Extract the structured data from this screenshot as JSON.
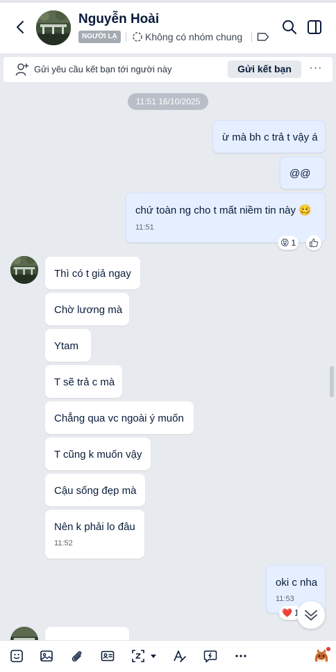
{
  "header": {
    "contact_name": "Nguyễn Hoài",
    "stranger_badge": "NGƯỜI LẠ",
    "mutual_groups": "Không có nhóm chung"
  },
  "friend_request": {
    "text": "Gửi yêu cầu kết bạn tới người này",
    "button_label": "Gửi kết bạn",
    "more_label": "···"
  },
  "conversation": {
    "date_divider": "11:51 16/10/2025",
    "messages": [
      {
        "sender": "me",
        "text": "ừ mà bh c trả t vậy á"
      },
      {
        "sender": "me",
        "text": "@@"
      },
      {
        "sender": "me",
        "text": "chứ toàn ng cho t mất niềm tin này",
        "emoji": "🥴",
        "time": "11:51",
        "reaction": {
          "emoji": "😝",
          "count": "1"
        }
      },
      {
        "sender": "them",
        "text": "Thì có t giả ngay"
      },
      {
        "sender": "them",
        "text": "Chờ lương mà"
      },
      {
        "sender": "them",
        "text": "Ytam"
      },
      {
        "sender": "them",
        "text": "T sẽ trả c mà"
      },
      {
        "sender": "them",
        "text": "Chẳng qua vc ngoài ý muốn"
      },
      {
        "sender": "them",
        "text": "T cũng k muốn vậy"
      },
      {
        "sender": "them",
        "text": "Cậu sống đẹp mà"
      },
      {
        "sender": "them",
        "text": "Nên k phải lo đâu",
        "time": "11:52"
      },
      {
        "sender": "me",
        "text": "oki c nha",
        "time": "11:53",
        "reaction": {
          "emoji": "❤️",
          "count": "1"
        }
      }
    ]
  },
  "toolbar": {
    "icons": [
      "sticker-icon",
      "image-icon",
      "attachment-icon",
      "contact-card-icon",
      "screenshot-icon",
      "format-text-icon",
      "quick-message-icon",
      "more-icon",
      "mascot-icon"
    ]
  },
  "colors": {
    "background": "#e7eaee",
    "my_bubble": "#e5efff",
    "their_bubble": "#ffffff",
    "badge": "#a5abb3",
    "accent": "#0068ff"
  }
}
